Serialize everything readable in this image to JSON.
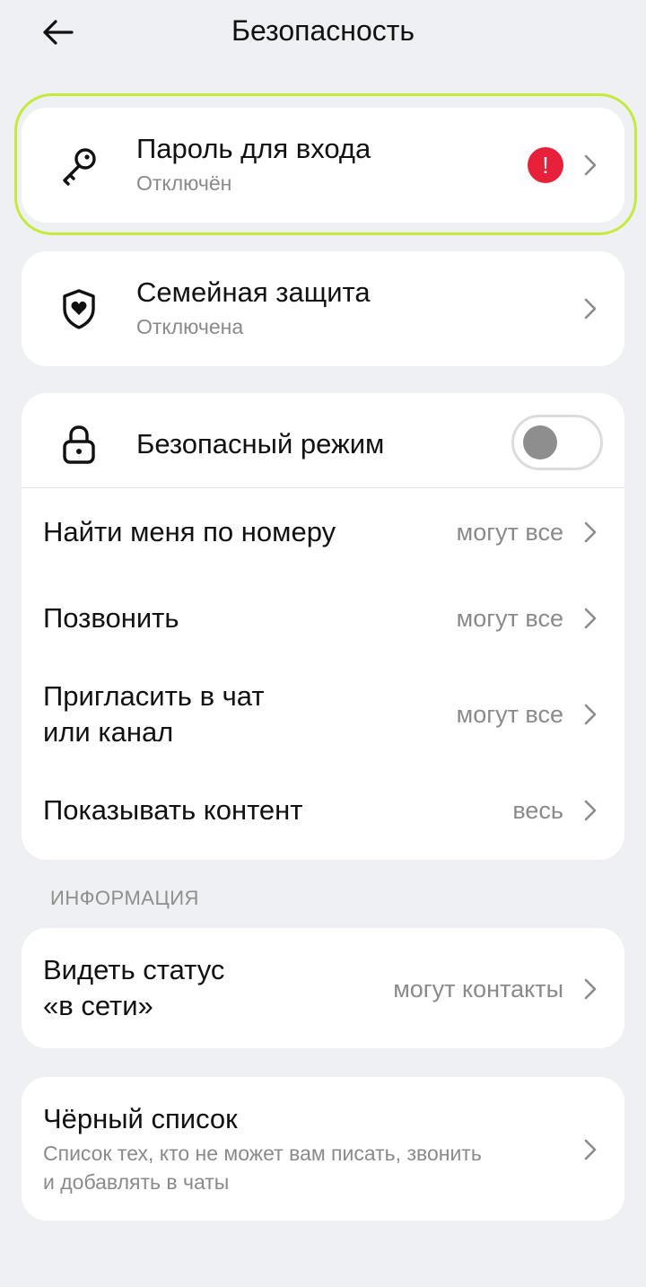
{
  "header": {
    "back_icon": "arrow-left-icon",
    "title": "Безопасность"
  },
  "password": {
    "icon": "key-icon",
    "title": "Пароль для входа",
    "status": "Отключён",
    "warning_mark": "!",
    "warning_color": "#e8213b",
    "highlight_color": "#c6ea3b"
  },
  "family": {
    "icon": "shield-heart-icon",
    "title": "Семейная защита",
    "status": "Отключена"
  },
  "safe_mode": {
    "icon": "lock-icon",
    "title": "Безопасный режим",
    "enabled": false
  },
  "privacy": [
    {
      "label_lines": [
        "Найти меня по номеру"
      ],
      "value": "могут все"
    },
    {
      "label_lines": [
        "Позвонить"
      ],
      "value": "могут все"
    },
    {
      "label_lines": [
        "Пригласить в чат",
        "или канал"
      ],
      "value": "могут все"
    },
    {
      "label_lines": [
        "Показывать контент"
      ],
      "value": "весь"
    }
  ],
  "info_section": {
    "label": "ИНФОРМАЦИЯ",
    "online_status": {
      "label_lines": [
        "Видеть статус",
        "«в сети»"
      ],
      "value": "могут контакты"
    }
  },
  "blacklist": {
    "title": "Чёрный список",
    "desc_lines": [
      "Список тех, кто не может вам писать, звонить",
      "и добавлять в чаты"
    ]
  }
}
